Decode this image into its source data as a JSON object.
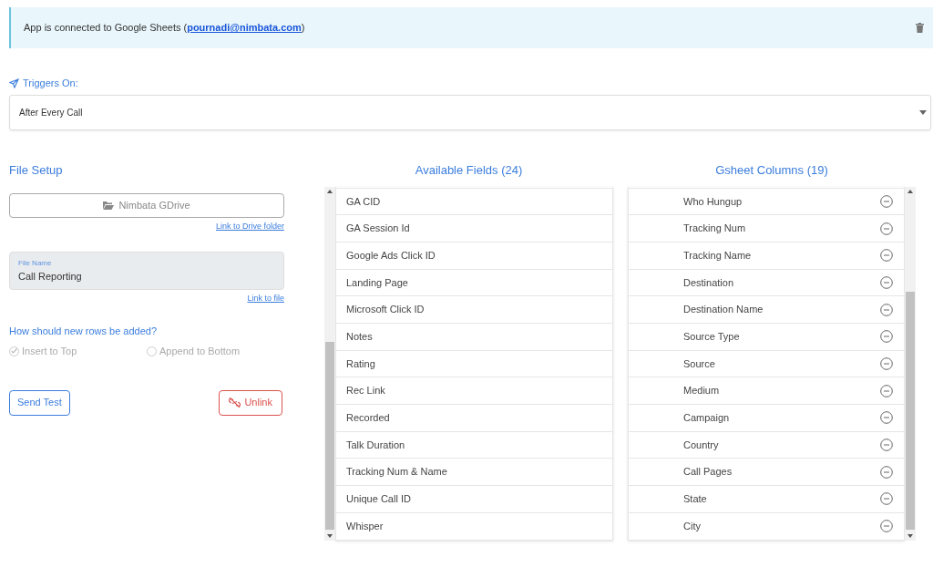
{
  "alert": {
    "text": "App is connected to Google Sheets (",
    "email": "pournadi@nimbata.com",
    "suffix": ")"
  },
  "trigger": {
    "label": "Triggers On:",
    "value": "After Every Call"
  },
  "file_setup": {
    "title": "File Setup",
    "drive_button": "Nimbata GDrive",
    "drive_link": "Link to Drive folder",
    "file_name_label": "File Name",
    "file_name": "Call Reporting",
    "file_link": "Link to file",
    "rows_question": "How should new rows be added?",
    "options": [
      {
        "label": "Insert to Top",
        "selected": true
      },
      {
        "label": "Append to Bottom",
        "selected": false
      }
    ],
    "send_test": "Send Test",
    "unlink": "Unlink"
  },
  "available_fields": {
    "title": "Available Fields (24)",
    "items": [
      "GA CID",
      "GA Session Id",
      "Google Ads Click ID",
      "Landing Page",
      "Microsoft Click ID",
      "Notes",
      "Rating",
      "Rec Link",
      "Recorded",
      "Talk Duration",
      "Tracking Num & Name",
      "Unique Call ID",
      "Whisper"
    ]
  },
  "gsheet_columns": {
    "title": "Gsheet Columns (19)",
    "items": [
      "Who Hungup",
      "Tracking Num",
      "Tracking Name",
      "Destination",
      "Destination Name",
      "Source Type",
      "Source",
      "Medium",
      "Campaign",
      "Country",
      "Call Pages",
      "State",
      "City"
    ]
  }
}
